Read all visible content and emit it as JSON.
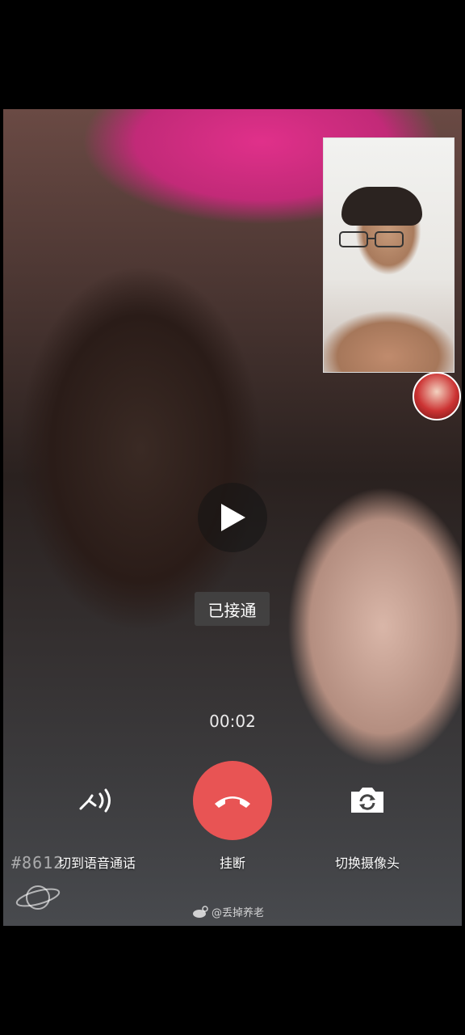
{
  "call": {
    "status": "已接通",
    "timer": "00:02"
  },
  "controls": {
    "switch_voice_label": "切到语音通话",
    "hangup_label": "挂断",
    "switch_camera_label": "切换摄像头"
  },
  "watermarks": {
    "left_tag": "#8612",
    "weibo_handle": "@丢掉养老"
  },
  "colors": {
    "hangup": "#e85454",
    "toast_bg": "#464646",
    "screen_bg": "#000000"
  },
  "icons": {
    "play": "play-icon",
    "switch_voice": "voice-wave-icon",
    "hangup": "phone-hangup-icon",
    "switch_camera": "camera-switch-icon"
  }
}
